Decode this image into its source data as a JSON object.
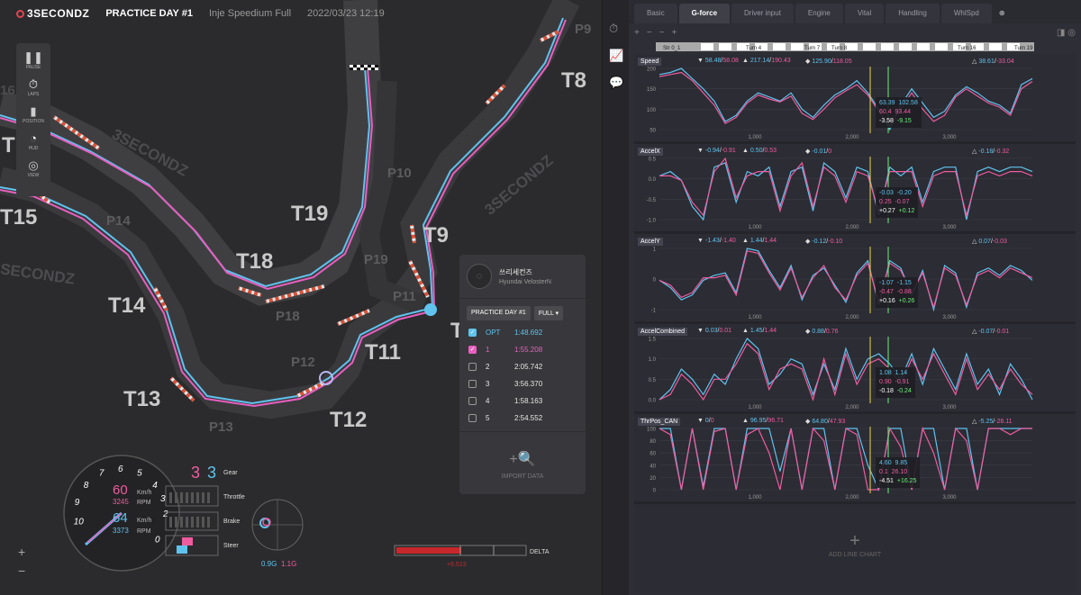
{
  "header": {
    "logo": "3SECONDZ",
    "session": "PRACTICE DAY #1",
    "track": "Inje Speedium Full",
    "datetime": "2022/03/23 12:19"
  },
  "left_panel": [
    {
      "label": "PAUSE",
      "icon": "pause-icon"
    },
    {
      "label": "LAPS",
      "icon": "stopwatch-icon"
    },
    {
      "label": "POSITION",
      "icon": "position-icon"
    },
    {
      "label": "HUD",
      "icon": "hud-icon"
    },
    {
      "label": "VIEW",
      "icon": "view-icon"
    }
  ],
  "map_labels": {
    "turns": [
      "T8",
      "T9",
      "T11",
      "T12",
      "T13",
      "T14",
      "T15",
      "T18",
      "T19",
      "T1",
      "T"
    ],
    "points": [
      "P9",
      "P10",
      "P11",
      "P12",
      "P13",
      "P14",
      "P18",
      "P19"
    ],
    "watermarks": [
      "3SECONDZ",
      "3SECONDZ",
      "SECONDZ",
      "16"
    ]
  },
  "driver": {
    "name": "쓰리세컨즈",
    "car": "Hyundai VelosterN",
    "session_select": "PRACTICE DAY #1",
    "mode_select": "FULL"
  },
  "laps": [
    {
      "num": "OPT",
      "time": "1:48.692",
      "checked": true,
      "color": "#5fc3ee"
    },
    {
      "num": "1",
      "time": "1:55.208",
      "checked": true,
      "color": "#e85fc0"
    },
    {
      "num": "2",
      "time": "2:05.742",
      "checked": false,
      "color": "#e6e6e6"
    },
    {
      "num": "3",
      "time": "3:56.370",
      "checked": false,
      "color": "#e6e6e6"
    },
    {
      "num": "4",
      "time": "1:58.163",
      "checked": false,
      "color": "#e6e6e6"
    },
    {
      "num": "5",
      "time": "2:54.552",
      "checked": false,
      "color": "#e6e6e6"
    }
  ],
  "import_label": "IMPORT DATA",
  "gauges": {
    "ticks": [
      "0",
      "2",
      "3",
      "4",
      "5",
      "6",
      "7",
      "8",
      "9",
      "10"
    ],
    "speed_pink": "60",
    "speed_blue": "64",
    "unit_speed": "Km/h",
    "rpm_pink": "3245",
    "rpm_blue": "3373",
    "unit_rpm": "RPM",
    "gear_pink": "3",
    "gear_blue": "3",
    "gear_label": "Gear",
    "throttle_label": "Throttle",
    "brake_label": "Brake",
    "steer_label": "Steer",
    "g_blue": "0.9G",
    "g_pink": "1.1G",
    "delta_label": "DELTA",
    "delta_value": "+6.513"
  },
  "tabs": [
    "Basic",
    "G-force",
    "Driver input",
    "Engine",
    "Vital",
    "Handling",
    "WhlSpd"
  ],
  "active_tab": "G-force",
  "turn_strip": [
    "Str 0_1",
    "Turn 4",
    "Turn 7",
    "Turn 8",
    "Turn 16",
    "Turn 19"
  ],
  "charts": [
    {
      "title": "Speed",
      "s1": [
        "58.48",
        "58.08"
      ],
      "s2": [
        "217.14",
        "190.43"
      ],
      "s3": [
        "125.90",
        "118.05"
      ],
      "delta": [
        "38.61",
        "-33.04"
      ],
      "yticks": [
        "200",
        "150",
        "100",
        "50"
      ],
      "xticks": [
        "1,000",
        "2,000",
        "3,000"
      ],
      "tip": [
        "63.39",
        "102.58",
        "60.4",
        "93.44",
        "-3.58",
        "-9.15"
      ],
      "series": [
        {
          "name": "OPT",
          "values": [
            185,
            190,
            200,
            175,
            150,
            120,
            70,
            85,
            120,
            140,
            130,
            120,
            140,
            100,
            80,
            110,
            135,
            150,
            170,
            140,
            100,
            50,
            110,
            150,
            115,
            80,
            95,
            135,
            155,
            140,
            120,
            110,
            90,
            160,
            175
          ]
        },
        {
          "name": "1",
          "values": [
            180,
            185,
            190,
            170,
            140,
            110,
            65,
            80,
            115,
            135,
            125,
            118,
            132,
            90,
            75,
            100,
            128,
            145,
            160,
            135,
            95,
            60,
            100,
            140,
            100,
            70,
            85,
            130,
            150,
            132,
            115,
            105,
            85,
            150,
            168
          ]
        }
      ]
    },
    {
      "title": "AccelX",
      "s1": [
        "-0.94",
        "-0.91"
      ],
      "s2": [
        "0.50",
        "0.53"
      ],
      "s3": [
        "-0.01",
        "0"
      ],
      "delta": [
        "-0.18",
        "-0.32"
      ],
      "yticks": [
        "0.5",
        "0.0",
        "-0.5",
        "-1.0"
      ],
      "xticks": [
        "1,000",
        "2,000",
        "3,000"
      ],
      "tip": [
        "-0.03",
        "-0.20",
        "0.25",
        "-0.07",
        "+0.27",
        "+0.12"
      ],
      "series": [
        {
          "name": "OPT",
          "values": [
            0.1,
            0.2,
            0.0,
            -0.6,
            -0.9,
            0.3,
            0.4,
            -0.5,
            0.2,
            0.1,
            0.3,
            -0.6,
            0.2,
            0.3,
            -0.7,
            0.4,
            0.2,
            -0.4,
            0.3,
            0.2,
            -0.8,
            0.3,
            0.1,
            0.3,
            -0.5,
            0.2,
            0.3,
            0.3,
            -0.9,
            0.2,
            0.3,
            0.2,
            0.3,
            0.3,
            0.2
          ]
        },
        {
          "name": "1",
          "values": [
            0.1,
            0.1,
            0.0,
            -0.5,
            -0.8,
            0.2,
            0.5,
            -0.4,
            0.1,
            0.2,
            0.2,
            -0.7,
            0.1,
            0.4,
            -0.6,
            0.3,
            0.1,
            -0.5,
            0.2,
            0.1,
            -0.7,
            0.2,
            0.2,
            0.2,
            -0.6,
            0.1,
            0.2,
            0.2,
            -0.8,
            0.1,
            0.2,
            0.1,
            0.2,
            0.2,
            0.1
          ]
        }
      ]
    },
    {
      "title": "AccelY",
      "s1": [
        "-1.43",
        "-1.40"
      ],
      "s2": [
        "1.44",
        "1.44"
      ],
      "s3": [
        "-0.12",
        "-0.10"
      ],
      "delta": [
        "0.07",
        "-0.03"
      ],
      "yticks": [
        "1",
        "0",
        "-1"
      ],
      "xticks": [
        "1,000",
        "2,000",
        "3,000"
      ],
      "tip": [
        "-1.07",
        "-1.15",
        "-0.47",
        "-0.88",
        "+0.16",
        "+0.26"
      ],
      "series": [
        {
          "name": "OPT",
          "values": [
            0.0,
            -0.3,
            -0.8,
            -0.6,
            0.0,
            0.2,
            0.3,
            -0.5,
            1.3,
            1.2,
            0.4,
            -0.3,
            0.6,
            -0.8,
            0.2,
            0.5,
            -0.2,
            -0.9,
            0.3,
            0.8,
            -1.0,
            0.8,
            0.5,
            -0.6,
            0.4,
            -1.2,
            0.6,
            0.3,
            -1.1,
            0.3,
            0.5,
            0.2,
            0.6,
            0.4,
            0.0
          ]
        },
        {
          "name": "1",
          "values": [
            0.0,
            -0.2,
            -0.7,
            -0.5,
            0.1,
            0.1,
            0.2,
            -0.6,
            1.2,
            1.1,
            0.3,
            -0.4,
            0.5,
            -0.7,
            0.1,
            0.6,
            -0.3,
            -0.8,
            0.2,
            0.7,
            -0.9,
            0.7,
            0.4,
            -0.5,
            0.3,
            -1.1,
            0.5,
            0.2,
            -1.0,
            0.2,
            0.4,
            0.1,
            0.5,
            0.3,
            0.1
          ]
        }
      ]
    },
    {
      "title": "AccelCombined",
      "s1": [
        "0.03",
        "0.01"
      ],
      "s2": [
        "1.45",
        "1.44"
      ],
      "s3": [
        "0.88",
        "0.76"
      ],
      "delta": [
        "-0.07",
        "-0.01"
      ],
      "yticks": [
        "1.5",
        "1.0",
        "0.5",
        "0.0"
      ],
      "xticks": [
        "1,000",
        "2,000",
        "3,000"
      ],
      "tip": [
        "1.08",
        "1.14",
        "0.90",
        "-0.91",
        "-0.18",
        "-0.24"
      ],
      "series": [
        {
          "name": "OPT",
          "values": [
            0.2,
            0.4,
            0.8,
            0.6,
            0.3,
            0.7,
            0.5,
            1.0,
            1.4,
            1.2,
            0.5,
            0.7,
            1.0,
            0.9,
            0.3,
            0.9,
            0.4,
            1.2,
            0.6,
            1.0,
            1.1,
            0.9,
            0.6,
            1.1,
            0.5,
            1.2,
            0.8,
            0.4,
            1.1,
            0.5,
            0.8,
            0.3,
            0.9,
            0.6,
            0.2
          ]
        },
        {
          "name": "1",
          "values": [
            0.2,
            0.3,
            0.7,
            0.5,
            0.2,
            0.6,
            0.6,
            0.9,
            1.3,
            1.1,
            0.4,
            0.8,
            0.9,
            0.8,
            0.2,
            1.0,
            0.3,
            1.1,
            0.5,
            0.9,
            1.0,
            0.8,
            0.5,
            1.0,
            0.6,
            1.1,
            0.7,
            0.3,
            1.0,
            0.4,
            0.7,
            0.4,
            0.8,
            0.5,
            0.3
          ]
        }
      ]
    },
    {
      "title": "ThrPos_CAN",
      "s1": [
        "0",
        "0"
      ],
      "s2": [
        "96.95",
        "96.71"
      ],
      "s3": [
        "64.80",
        "47.93"
      ],
      "delta": [
        "-5.25",
        "-26.11"
      ],
      "yticks": [
        "100",
        "80",
        "60",
        "40",
        "20",
        "0"
      ],
      "xticks": [
        "1,000",
        "2,000",
        "3,000"
      ],
      "tip": [
        "4.60",
        "9.85",
        "0.1",
        "26.10",
        "-4.51",
        "+16.25"
      ],
      "series": [
        {
          "name": "OPT",
          "values": [
            100,
            100,
            0,
            100,
            5,
            100,
            100,
            0,
            100,
            100,
            100,
            30,
            100,
            0,
            100,
            100,
            0,
            100,
            100,
            40,
            0,
            100,
            100,
            0,
            100,
            100,
            0,
            100,
            100,
            0,
            100,
            100,
            100,
            100,
            100
          ]
        },
        {
          "name": "1",
          "values": [
            100,
            90,
            0,
            100,
            0,
            95,
            100,
            0,
            90,
            100,
            60,
            0,
            100,
            0,
            100,
            80,
            0,
            100,
            90,
            0,
            0,
            100,
            70,
            0,
            100,
            60,
            0,
            100,
            80,
            0,
            100,
            100,
            90,
            100,
            100
          ]
        }
      ]
    }
  ],
  "add_chart_label": "ADD LINE CHART",
  "colors": {
    "blue": "#5fc3ee",
    "pink": "#ee5c9f",
    "green": "#6ef07a",
    "yellow": "#e8d84a"
  }
}
